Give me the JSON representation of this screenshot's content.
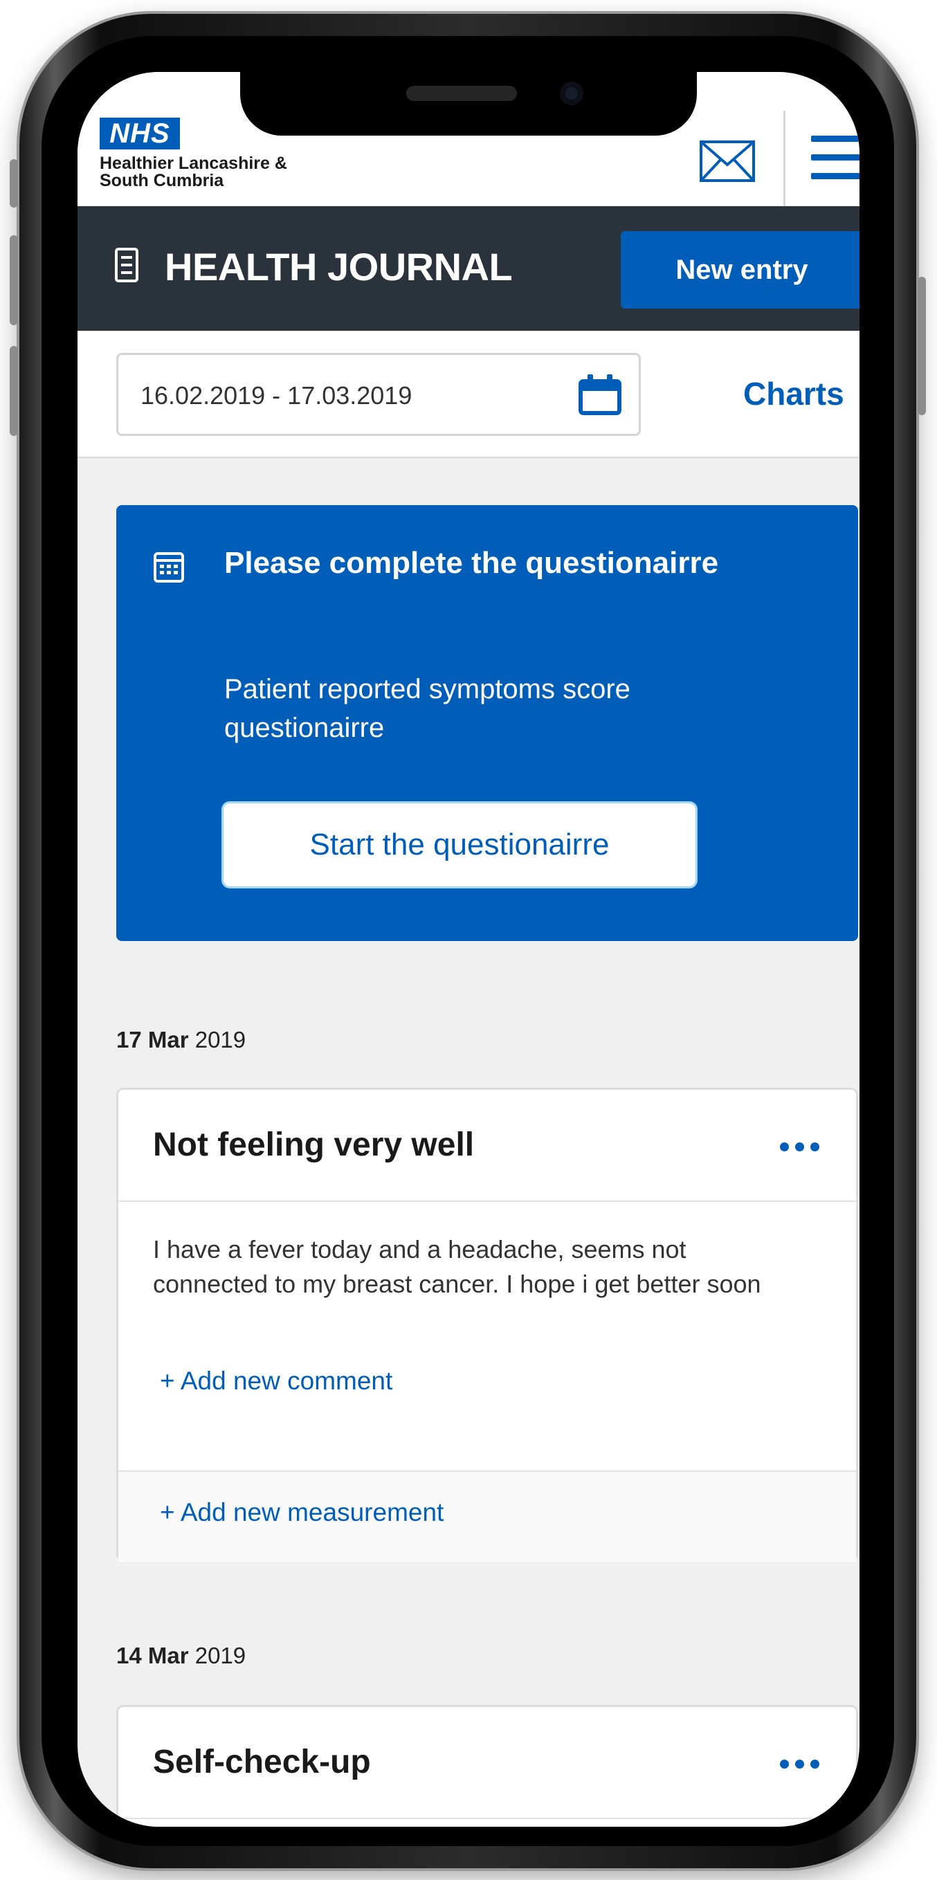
{
  "header": {
    "logo_text": "NHS",
    "org_name": "Healthier Lancashire &\nSouth Cumbria"
  },
  "title_bar": {
    "title": "HEALTH JOURNAL",
    "new_entry_label": "New entry"
  },
  "filter": {
    "date_range": "16.02.2019 - 17.03.2019",
    "charts_label": "Charts"
  },
  "questionnaire": {
    "title": "Please complete the questionairre",
    "description": "Patient reported symptoms score questionairre",
    "button_label": "Start the questionairre"
  },
  "entries": [
    {
      "date_bold": "17 Mar",
      "date_year": " 2019",
      "title": "Not feeling very well",
      "body": "I have a fever today and a headache, seems not connected to my breast cancer. I hope i get better soon",
      "add_comment_label": "+ Add new comment",
      "add_measurement_label": "+ Add new measurement"
    },
    {
      "date_bold": "14 Mar",
      "date_year": " 2019",
      "title": "Self-check-up"
    }
  ],
  "colors": {
    "nhs_blue": "#005eb8",
    "title_bar": "#2a323b",
    "background": "#f0f0f0"
  }
}
